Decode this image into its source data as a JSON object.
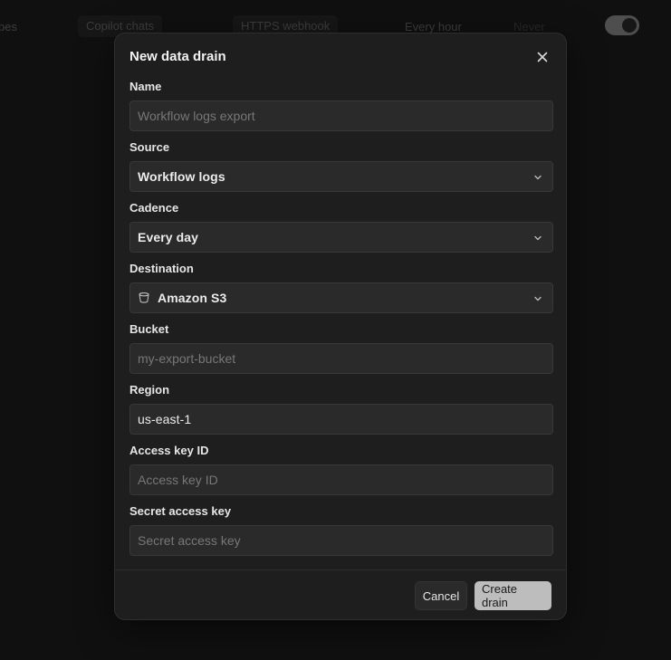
{
  "background": {
    "row_cells": [
      "pes",
      "Copilot chats",
      "HTTPS webhook",
      "Every hour",
      "Never"
    ]
  },
  "modal": {
    "title": "New data drain",
    "close_icon": "close-icon",
    "fields": {
      "name": {
        "label": "Name",
        "placeholder": "Workflow logs export",
        "value": ""
      },
      "source": {
        "label": "Source",
        "value": "Workflow logs"
      },
      "cadence": {
        "label": "Cadence",
        "value": "Every day"
      },
      "destination": {
        "label": "Destination",
        "value": "Amazon S3",
        "icon": "bucket-icon"
      },
      "bucket": {
        "label": "Bucket",
        "placeholder": "my-export-bucket",
        "value": ""
      },
      "region": {
        "label": "Region",
        "value": "us-east-1"
      },
      "access_key_id": {
        "label": "Access key ID",
        "placeholder": "Access key ID",
        "value": ""
      },
      "secret_access_key": {
        "label": "Secret access key",
        "placeholder": "Secret access key",
        "value": ""
      }
    },
    "footer": {
      "cancel_label": "Cancel",
      "create_label": "Create drain"
    }
  },
  "colors": {
    "page_bg": "#161616",
    "modal_bg": "#1e1e1e",
    "input_bg": "#2a2a2a",
    "primary_button": "#bdbdbd"
  }
}
